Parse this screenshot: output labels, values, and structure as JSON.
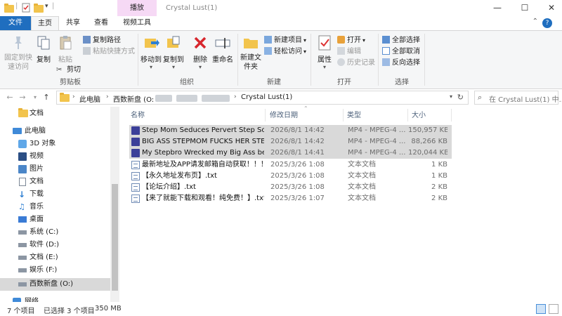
{
  "window": {
    "title": "Crystal Lust(1)",
    "context_tab": "播放",
    "controls": {
      "minimize": "—",
      "maximize": "☐",
      "close": "✕"
    }
  },
  "ribbon": {
    "tabs": [
      {
        "label": "文件"
      },
      {
        "label": "主页"
      },
      {
        "label": "共享"
      },
      {
        "label": "查看"
      },
      {
        "label": "视频工具"
      }
    ],
    "clipboard": {
      "label": "剪贴板",
      "pin": "固定到快速访问",
      "copy": "复制",
      "paste": "粘贴",
      "copy_path": "复制路径",
      "paste_shortcut": "粘贴快捷方式",
      "cut": "剪切"
    },
    "organize": {
      "label": "组织",
      "move_to": "移动到",
      "copy_to": "复制到",
      "delete": "删除",
      "rename": "重命名"
    },
    "new": {
      "label": "新建",
      "new_folder": "新建文件夹",
      "new_item": "新建项目",
      "easy_access": "轻松访问"
    },
    "open": {
      "label": "打开",
      "properties": "属性",
      "open": "打开",
      "edit": "编辑",
      "history": "历史记录"
    },
    "select": {
      "label": "选择",
      "select_all": "全部选择",
      "select_none": "全部取消",
      "invert": "反向选择"
    }
  },
  "address": {
    "crumbs": [
      "此电脑",
      "西数新盘 (O:",
      "Crystal Lust(1)"
    ],
    "search_placeholder": "在 Crystal Lust(1) 中..."
  },
  "nav": {
    "items": [
      {
        "label": "文档",
        "icon": "folder-icon"
      },
      {
        "label": "此电脑",
        "icon": "computer-icon"
      },
      {
        "label": "3D 对象",
        "icon": "3d-objects-icon"
      },
      {
        "label": "视频",
        "icon": "videos-icon"
      },
      {
        "label": "图片",
        "icon": "pictures-icon"
      },
      {
        "label": "文档",
        "icon": "documents-icon"
      },
      {
        "label": "下载",
        "icon": "downloads-icon"
      },
      {
        "label": "音乐",
        "icon": "music-icon"
      },
      {
        "label": "桌面",
        "icon": "desktop-icon"
      },
      {
        "label": "系统 (C:)",
        "icon": "drive-icon"
      },
      {
        "label": "软件 (D:)",
        "icon": "drive-icon"
      },
      {
        "label": "文档 (E:)",
        "icon": "drive-icon"
      },
      {
        "label": "娱乐 (F:)",
        "icon": "drive-icon"
      },
      {
        "label": "西数新盘 (O:)",
        "icon": "drive-icon"
      },
      {
        "label": "网络",
        "icon": "network-icon"
      }
    ]
  },
  "filelist": {
    "columns": {
      "name": "名称",
      "date": "修改日期",
      "type": "类型",
      "size": "大小"
    },
    "rows": [
      {
        "name": "Step Mom Seduces Pervert Step Son...",
        "date": "2026/8/1 14:42",
        "type": "MP4 - MPEG-4 ...",
        "size": "150,957 KB",
        "selected": true,
        "kind": "video"
      },
      {
        "name": "BIG ASS STEPMOM FUCKS HER STEP...",
        "date": "2026/8/1 14:42",
        "type": "MP4 - MPEG-4 ...",
        "size": "88,266 KB",
        "selected": true,
        "kind": "video"
      },
      {
        "name": "My Stepbro Wrecked my Big Ass bef...",
        "date": "2026/8/1 14:41",
        "type": "MP4 - MPEG-4 ...",
        "size": "120,044 KB",
        "selected": true,
        "kind": "video"
      },
      {
        "name": "最新地址及APP请发邮箱自动获取！！！...",
        "date": "2025/3/26 1:08",
        "type": "文本文档",
        "size": "1 KB",
        "selected": false,
        "kind": "text"
      },
      {
        "name": "【永久地址发布页】.txt",
        "date": "2025/3/26 1:08",
        "type": "文本文档",
        "size": "1 KB",
        "selected": false,
        "kind": "text"
      },
      {
        "name": "【论坛介绍】.txt",
        "date": "2025/3/26 1:08",
        "type": "文本文档",
        "size": "2 KB",
        "selected": false,
        "kind": "text"
      },
      {
        "name": "【来了就能下载和观看！纯免费！】.txt",
        "date": "2025/3/26 1:07",
        "type": "文本文档",
        "size": "2 KB",
        "selected": false,
        "kind": "text"
      }
    ]
  },
  "status": {
    "count": "7 个项目",
    "selection": "已选择 3 个项目",
    "size": "350 MB"
  },
  "colors": {
    "accent": "#1f6ebf",
    "context_tab": "#f6d9f5",
    "selection": "#d9d9d9"
  }
}
